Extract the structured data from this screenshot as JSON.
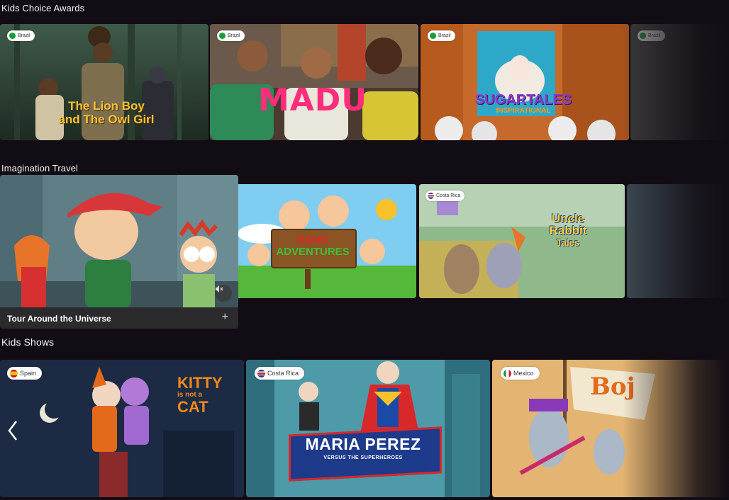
{
  "rows": [
    {
      "title": "Kids Choice Awards",
      "cards": [
        {
          "country": "Brazil",
          "title_art": "The Lion Boy and The Owl Girl",
          "line1": "The Lion Boy",
          "line2": "and The Owl Girl"
        },
        {
          "country": "Brazil",
          "title_art": "MADU"
        },
        {
          "country": "Brazil",
          "title_art": "SUGARTALES",
          "subtitle_art": "INSPIRATIONAL"
        },
        {
          "country": "Brazil"
        }
      ]
    },
    {
      "title": "Imagination Travel",
      "cards": [
        {
          "title": "Tour Around the Universe"
        },
        {
          "line1": "NANO",
          "line2": "ADVENTURES"
        },
        {
          "country": "Costa Rica",
          "line1": "Uncle",
          "line2": "Rabbit",
          "line3": "Tales"
        },
        {}
      ]
    },
    {
      "title": "Kids Shows",
      "cards": [
        {
          "country": "Spain",
          "line1": "KITTY",
          "line2": "is not a",
          "line3": "CAT"
        },
        {
          "country": "Costa Rica",
          "line1": "MARIA PEREZ",
          "line2": "VERSUS THE SUPERHEROES"
        },
        {
          "country": "Mexico",
          "title_art": "Boj"
        }
      ]
    }
  ],
  "icons": {
    "mute": "speaker-mute-icon",
    "add": "plus-icon",
    "prev": "chevron-left-icon",
    "plus_glyph": "+"
  },
  "colors": {
    "background": "#120d14",
    "brazil": "#1a9b3c",
    "costa_rica": "#d21f2b",
    "spain": "#d6262c",
    "mexico": "#1b8a4a"
  }
}
